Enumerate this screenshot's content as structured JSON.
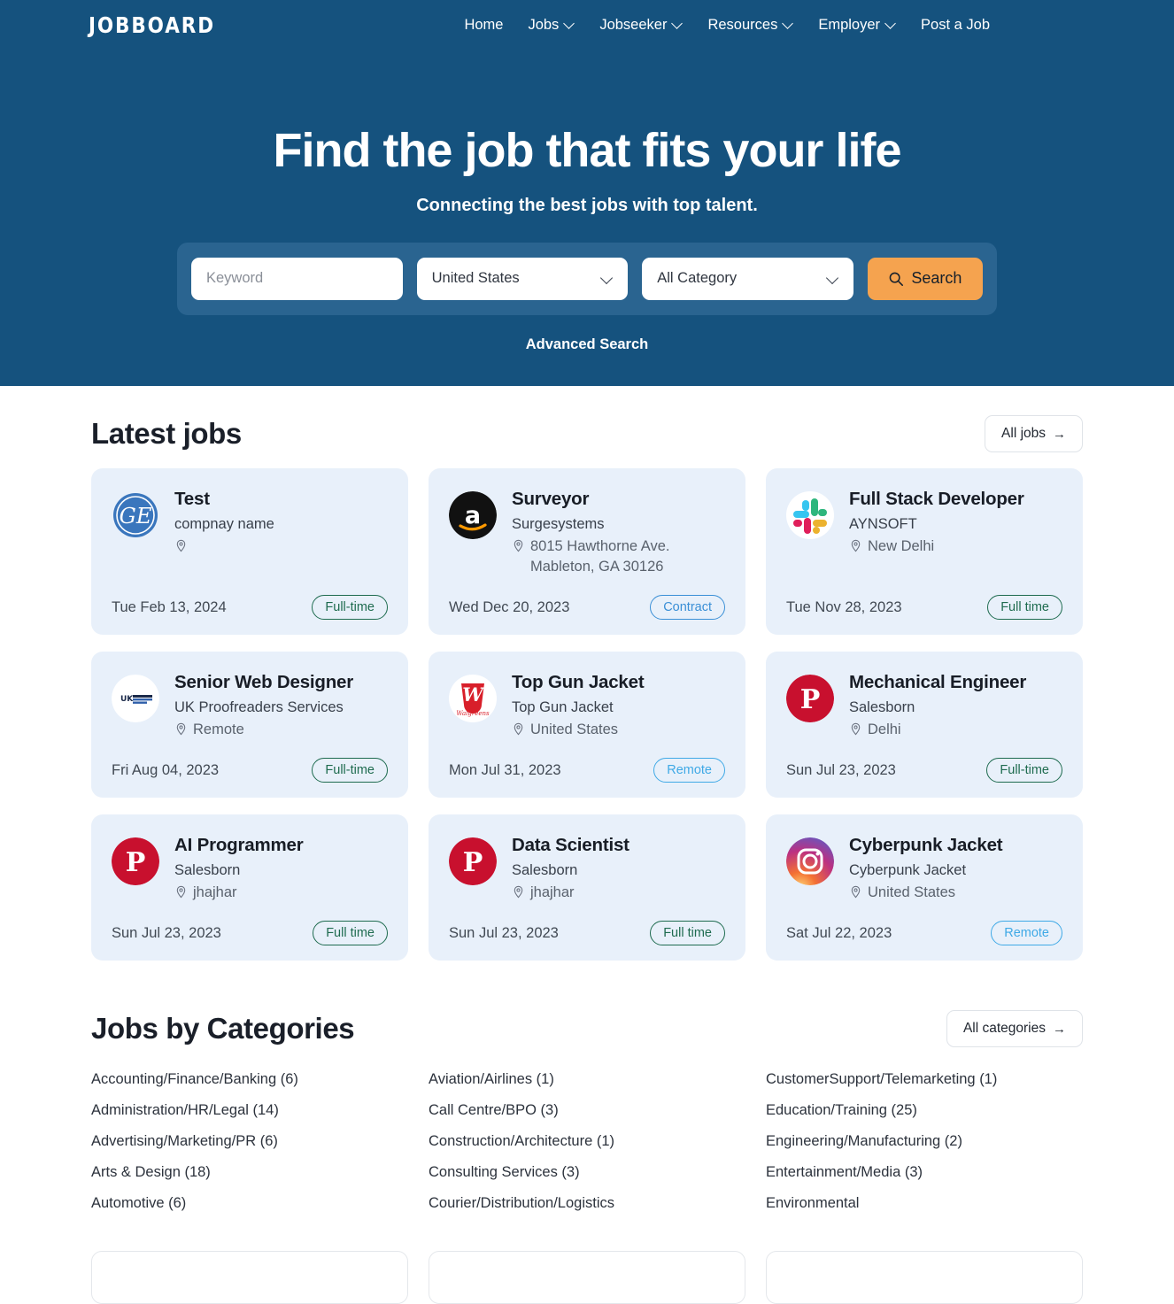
{
  "brand": {
    "logo_text": "JOBBOARD"
  },
  "nav": {
    "items": [
      {
        "label": "Home",
        "has_dropdown": false
      },
      {
        "label": "Jobs",
        "has_dropdown": true
      },
      {
        "label": "Jobseeker",
        "has_dropdown": true
      },
      {
        "label": "Resources",
        "has_dropdown": true
      },
      {
        "label": "Employer",
        "has_dropdown": true
      },
      {
        "label": "Post a Job",
        "has_dropdown": false
      }
    ]
  },
  "hero": {
    "title": "Find the job that fits your life",
    "subtitle": "Connecting the best jobs with top talent.",
    "advanced_search": "Advanced Search",
    "background_color": "#15527e",
    "searchbar_color": "#2a6490"
  },
  "search": {
    "keyword_placeholder": "Keyword",
    "keyword_value": "",
    "location_value": "United States",
    "category_value": "All Category",
    "button_label": "Search",
    "button_color": "#f5a34f"
  },
  "latest_jobs": {
    "title": "Latest jobs",
    "all_button": "All jobs",
    "jobs": [
      {
        "title": "Test",
        "company": "compnay name",
        "location": "",
        "date": "Tue Feb 13, 2024",
        "tag": "Full-time",
        "tag_color": "green",
        "logo": "ge-logo"
      },
      {
        "title": "Surveyor",
        "company": "Surgesystems",
        "location": "8015 Hawthorne Ave. Mableton, GA 30126",
        "date": "Wed Dec 20, 2023",
        "tag": "Contract",
        "tag_color": "blue",
        "logo": "amazon-logo"
      },
      {
        "title": "Full Stack Developer",
        "company": "AYNSOFT",
        "location": "New Delhi",
        "date": "Tue Nov 28, 2023",
        "tag": "Full time",
        "tag_color": "green",
        "logo": "slack-logo"
      },
      {
        "title": "Senior Web Designer",
        "company": "UK Proofreaders Services",
        "location": "Remote",
        "date": "Fri Aug 04, 2023",
        "tag": "Full-time",
        "tag_color": "green",
        "logo": "ukproofreaders-logo"
      },
      {
        "title": "Top Gun Jacket",
        "company": "Top Gun Jacket",
        "location": "United States",
        "date": "Mon Jul 31, 2023",
        "tag": "Remote",
        "tag_color": "cyan",
        "logo": "walgreens-logo"
      },
      {
        "title": "Mechanical Engineer",
        "company": "Salesborn",
        "location": "Delhi",
        "date": "Sun Jul 23, 2023",
        "tag": "Full-time",
        "tag_color": "green",
        "logo": "pinterest-logo"
      },
      {
        "title": "AI Programmer",
        "company": "Salesborn",
        "location": "jhajhar",
        "date": "Sun Jul 23, 2023",
        "tag": "Full time",
        "tag_color": "green",
        "logo": "pinterest-logo"
      },
      {
        "title": "Data Scientist",
        "company": "Salesborn",
        "location": "jhajhar",
        "date": "Sun Jul 23, 2023",
        "tag": "Full time",
        "tag_color": "green",
        "logo": "pinterest-logo"
      },
      {
        "title": "Cyberpunk Jacket",
        "company": "Cyberpunk Jacket",
        "location": "United States",
        "date": "Sat Jul 22, 2023",
        "tag": "Remote",
        "tag_color": "cyan",
        "logo": "instagram-logo"
      }
    ]
  },
  "categories": {
    "title": "Jobs by Categories",
    "all_button": "All categories",
    "columns": [
      [
        "Accounting/Finance/Banking (6)",
        "Administration/HR/Legal (14)",
        "Advertising/Marketing/PR (6)",
        "Arts & Design (18)",
        "Automotive (6)"
      ],
      [
        "Aviation/Airlines (1)",
        "Call Centre/BPO (3)",
        "Construction/Architecture (1)",
        "Consulting Services (3)",
        "Courier/Distribution/Logistics"
      ],
      [
        "CustomerSupport/Telemarketing (1)",
        "Education/Training (25)",
        "Engineering/Manufacturing (2)",
        "Entertainment/Media (3)",
        "Environmental"
      ]
    ]
  },
  "icons": {
    "arrow_right": "→",
    "location_pin": "location-pin-icon",
    "search": "search-icon",
    "chevron_down": "chevron-down-icon"
  }
}
